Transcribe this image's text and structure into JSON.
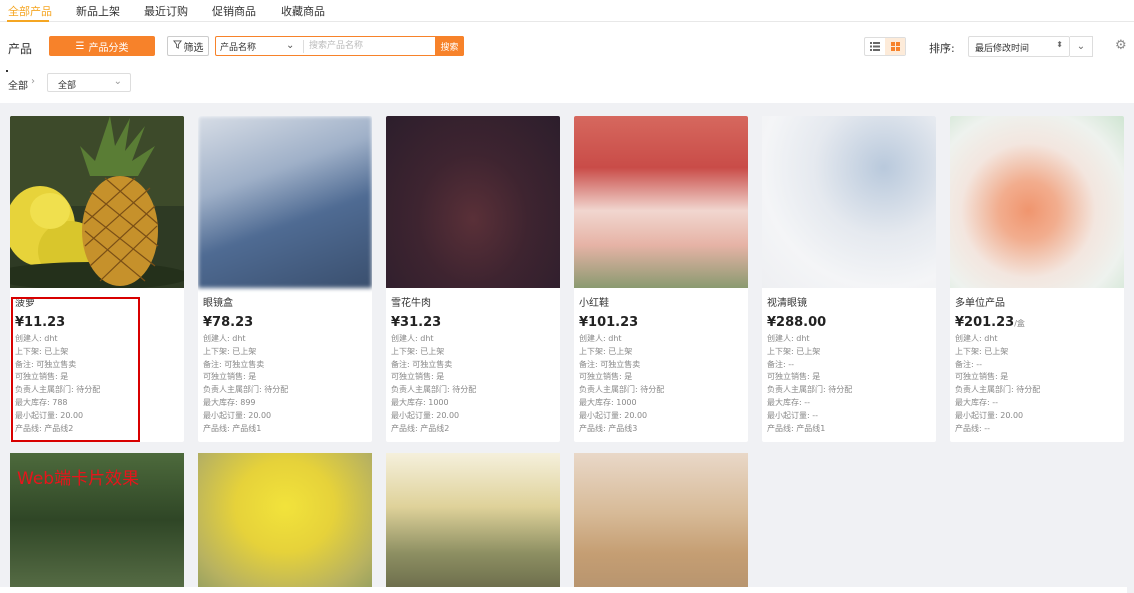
{
  "tabs": [
    {
      "label": "全部产品",
      "active": true
    },
    {
      "label": "新品上架",
      "active": false
    },
    {
      "label": "最近订购",
      "active": false
    },
    {
      "label": "促销商品",
      "active": false
    },
    {
      "label": "收藏商品",
      "active": false
    }
  ],
  "toolbar": {
    "product_label": "产品",
    "category_button": "产品分类",
    "filter_button": "筛选",
    "search_field": "产品名称",
    "search_placeholder": "搜索产品名称",
    "search_button": "搜索",
    "sort_label": "排序:",
    "sort_value": "最后修改时间"
  },
  "breadcrumb": {
    "root": "全部",
    "separator": "›",
    "select_value": "全部"
  },
  "colors": {
    "accent": "#f7822a",
    "highlight_border": "#d80000",
    "annotation_text": "#e8141b"
  },
  "products": [
    {
      "name": "菠萝",
      "price": "¥11.23",
      "unit": "",
      "attrs": [
        "创建人: dht",
        "上下架: 已上架",
        "备注: 可独立售卖",
        "可独立销售: 是",
        "负责人主属部门: 待分配",
        "最大库存: 788",
        "最小起订量: 20.00",
        "产品线: 产品线2"
      ]
    },
    {
      "name": "眼镜盒",
      "price": "¥78.23",
      "unit": "",
      "attrs": [
        "创建人: dht",
        "上下架: 已上架",
        "备注: 可独立售卖",
        "可独立销售: 是",
        "负责人主属部门: 待分配",
        "最大库存: 899",
        "最小起订量: 20.00",
        "产品线: 产品线1"
      ]
    },
    {
      "name": "雪花牛肉",
      "price": "¥31.23",
      "unit": "",
      "attrs": [
        "创建人: dht",
        "上下架: 已上架",
        "备注: 可独立售卖",
        "可独立销售: 是",
        "负责人主属部门: 待分配",
        "最大库存: 1000",
        "最小起订量: 20.00",
        "产品线: 产品线2"
      ]
    },
    {
      "name": "小红鞋",
      "price": "¥101.23",
      "unit": "",
      "attrs": [
        "创建人: dht",
        "上下架: 已上架",
        "备注: 可独立售卖",
        "可独立销售: 是",
        "负责人主属部门: 待分配",
        "最大库存: 1000",
        "最小起订量: 20.00",
        "产品线: 产品线3"
      ]
    },
    {
      "name": "视清眼镜",
      "price": "¥288.00",
      "unit": "",
      "attrs": [
        "创建人: dht",
        "上下架: 已上架",
        "备注: --",
        "可独立销售: 是",
        "负责人主属部门: 待分配",
        "最大库存: --",
        "最小起订量: --",
        "产品线: 产品线1"
      ]
    },
    {
      "name": "多单位产品",
      "price": "¥201.23",
      "unit": "/盒",
      "attrs": [
        "创建人: dht",
        "上下架: 已上架",
        "备注: --",
        "可独立销售: 是",
        "负责人主属部门: 待分配",
        "最大库存: --",
        "最小起订量: 20.00",
        "产品线: --"
      ]
    }
  ],
  "annotation": "Web端卡片效果"
}
